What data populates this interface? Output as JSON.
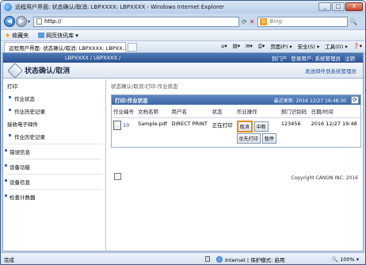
{
  "window": {
    "title": "远程用户界面: 状态确认/取消: LBPXXXX: LBPXXXX - Windows Internet Explorer",
    "controls": [
      "_",
      "□",
      "X"
    ]
  },
  "nav": {
    "address": "http://",
    "search_placeholder": "Bing"
  },
  "favorites": {
    "label": "收藏夹",
    "item": "网页快讯库 ▾"
  },
  "tab": {
    "label": "远程用户界面: 状态确认/取消: LBPXXXX: LBPXX..."
  },
  "command_bar": {
    "page": "页面(P) ▾",
    "safety": "安全(S) ▾",
    "tools": "工具(O) ▾",
    "help": "❓▾"
  },
  "rui": {
    "model": "LBPXXXX / LBPXXXX /",
    "links": [
      "到门户",
      "登录用户: 系统管理员",
      "注销"
    ],
    "page_title": "状态确认/取消",
    "admin_mail": "发送邮件到系统管理员",
    "breadcrumb": "状态确认/取消:打印:作业状态"
  },
  "sidebar": {
    "items": [
      {
        "label": "打印",
        "type": "group"
      },
      {
        "label": "作业状态",
        "type": "item"
      },
      {
        "label": "作业历史记录",
        "type": "item"
      },
      {
        "label": "接收电子邮件",
        "type": "group"
      },
      {
        "label": "作业历史记录",
        "type": "item"
      },
      {
        "label": "错误信息",
        "type": "top"
      },
      {
        "label": "设备功能",
        "type": "top"
      },
      {
        "label": "设备信息",
        "type": "top"
      },
      {
        "label": "检查计数器",
        "type": "top"
      }
    ]
  },
  "panel": {
    "title": "打印:作业状态",
    "last_updated": "最近更新: 2016 12/27 19:48:30",
    "columns": [
      "作业编号",
      "文档名称",
      "用户名",
      "状态",
      "作业操作",
      "部门识别码",
      "日期/时间"
    ],
    "rows": [
      {
        "job_no": "10",
        "doc_name": "Sample.pdf",
        "user": "DIRECT PRINT",
        "status": "正在打印",
        "actions": [
          "取消",
          "中断",
          "优先打印",
          "暂停"
        ],
        "dept_id": "123456",
        "datetime": "2016 12/27 19:48"
      }
    ]
  },
  "copyright": "Copyright CANON INC. 2016",
  "statusbar": {
    "left": "完成",
    "zone": "Internet | 保护模式: 启用",
    "zoom": "🔍 100% ▾"
  }
}
